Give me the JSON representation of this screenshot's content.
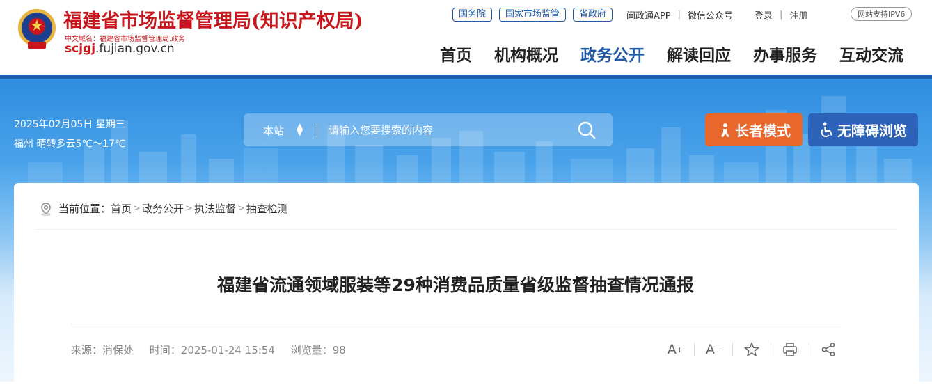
{
  "header": {
    "site_title": "福建省市场监督管理局(知识产权局)",
    "cn_domain": "中文域名：福建省市场监督管理局.政务",
    "domain_prefix": "scjgj",
    "domain_suffix": ".fujian.gov.cn",
    "top_links": {
      "pill1": "国务院",
      "pill2": "国家市场监管",
      "pill3": "省政府",
      "app": "闽政通APP",
      "wechat": "微信公众号",
      "login": "登录",
      "register": "注册",
      "ipv6": "网站支持IPV6"
    },
    "nav": {
      "home": "首页",
      "org": "机构概况",
      "gov": "政务公开",
      "interpret": "解读回应",
      "service": "办事服务",
      "interact": "互动交流"
    }
  },
  "banner": {
    "date": "2025年02月05日 星期三",
    "weather": "福州 晴转多云5℃～17℃",
    "search_scope": "本站",
    "search_placeholder": "请输入您要搜索的内容",
    "elder_mode": "长者模式",
    "accessible": "无障碍浏览"
  },
  "breadcrumb": {
    "prefix": "当前位置：",
    "items": [
      "首页",
      "政务公开",
      "执法监督",
      "抽查检测"
    ]
  },
  "article": {
    "title": "福建省流通领域服装等29种消费品质量省级监督抽查情况通报",
    "source": "来源：消保处",
    "time": "时间：2025-01-24 15:54",
    "views": "浏览量：98"
  },
  "colors": {
    "brand_red": "#c8161d",
    "brand_blue": "#1f5aa6",
    "elder_orange": "#e8682b",
    "access_blue": "#2c63b8"
  }
}
